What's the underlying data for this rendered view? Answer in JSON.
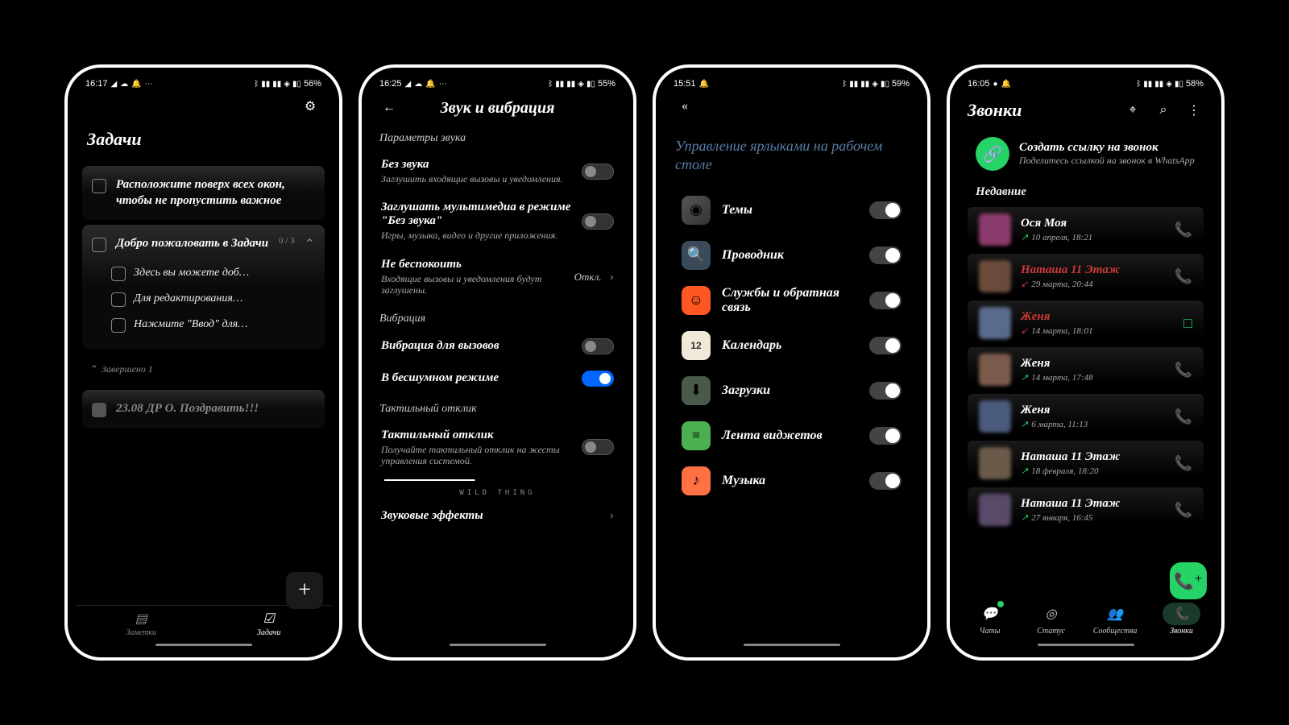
{
  "phone1": {
    "status": {
      "time": "16:17",
      "battery": "56%"
    },
    "title": "Задачи",
    "pinned": "Расположите поверх всех окон, чтобы не пропустить важное",
    "welcome": {
      "title": "Добро пожаловать в Задачи",
      "counter": "0 / 3",
      "subtasks": [
        "Здесь вы можете доб…",
        "Для редактирования…",
        "Нажмите \"Ввод\" для…"
      ]
    },
    "completed_label": "Завершено 1",
    "completed_task": "23.08 ДР О. Поздравить!!!",
    "nav": {
      "notes": "Заметки",
      "tasks": "Задачи"
    }
  },
  "phone2": {
    "status": {
      "time": "16:25",
      "battery": "55%"
    },
    "title": "Звук и вибрация",
    "section1": "Параметры звука",
    "s1": {
      "title": "Без звука",
      "desc": "Заглушить входящие вызовы и уведомления."
    },
    "s2": {
      "title": "Заглушать мультимедиа в режиме \"Без звука\"",
      "desc": "Игры, музыка, видео и другие приложения."
    },
    "s3": {
      "title": "Не беспокоить",
      "desc": "Входящие вызовы и уведомления будут заглушены.",
      "value": "Откл."
    },
    "section2": "Вибрация",
    "s4": {
      "title": "Вибрация для вызовов"
    },
    "s5": {
      "title": "В бесшумном режиме"
    },
    "section3": "Тактильный отклик",
    "s6": {
      "title": "Тактильный отклик",
      "desc": "Получайте тактильный отклик на жесты управления системой."
    },
    "brand": "WILD THING",
    "s7": "Звуковые эффекты"
  },
  "phone3": {
    "status": {
      "time": "15:51",
      "battery": "59%"
    },
    "title": "Управление ярлыками на рабочем столе",
    "items": [
      {
        "label": "Темы"
      },
      {
        "label": "Проводник"
      },
      {
        "label": "Службы и обратная связь"
      },
      {
        "label": "Календарь",
        "badge": "12"
      },
      {
        "label": "Загрузки"
      },
      {
        "label": "Лента виджетов"
      },
      {
        "label": "Музыка"
      }
    ]
  },
  "phone4": {
    "status": {
      "time": "16:05",
      "battery": "58%"
    },
    "title": "Звонки",
    "create_link": {
      "title": "Создать ссылку на звонок",
      "desc": "Поделитесь ссылкой на звонок в WhatsApp"
    },
    "recent": "Недавние",
    "calls": [
      {
        "name": "Ося Моя",
        "date": "10 апреля, 18:21",
        "type": "out-ok",
        "action": "call"
      },
      {
        "name": "Наташа 11 Этаж",
        "date": "29 марта, 20:44",
        "type": "missed",
        "action": "call"
      },
      {
        "name": "Женя",
        "date": "14 марта, 18:01",
        "type": "missed",
        "action": "video"
      },
      {
        "name": "Женя",
        "date": "14 марта, 17:48",
        "type": "out-ok",
        "action": "call"
      },
      {
        "name": "Женя",
        "date": "6 марта, 11:13",
        "type": "out-ok",
        "action": "call"
      },
      {
        "name": "Наташа 11 Этаж",
        "date": "18 февраля, 18:20",
        "type": "out-ok",
        "action": "call"
      },
      {
        "name": "Наташа 11 Этаж",
        "date": "27 января, 16:45",
        "type": "out-ok",
        "action": "call"
      }
    ],
    "nav": {
      "chats": "Чаты",
      "status": "Статус",
      "communities": "Сообщества",
      "calls": "Звонки"
    }
  }
}
